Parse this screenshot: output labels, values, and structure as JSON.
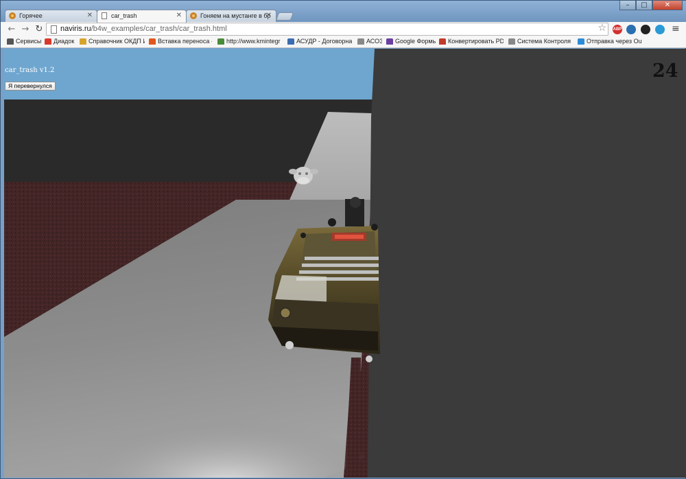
{
  "browser": {
    "tabs": [
      {
        "label": "Горячее",
        "active": false
      },
      {
        "label": "car_trash",
        "active": true
      },
      {
        "label": "Гоняем на мустанге в бр",
        "active": false
      }
    ],
    "url_host": "naviris.ru",
    "url_path": "/b4w_examples/car_trash/car_trash.html",
    "bookmarks": [
      {
        "label": "Сервисы",
        "color": "#555555"
      },
      {
        "label": "Диадок",
        "color": "#d9382c"
      },
      {
        "label": "Справочник ОКДП И",
        "color": "#d8a32a"
      },
      {
        "label": "Вставка переноса - V",
        "color": "#e2571e"
      },
      {
        "label": "http://www.kmintegr",
        "color": "#4a8a3b"
      },
      {
        "label": "АСУДР - Договорная",
        "color": "#3b6db0"
      },
      {
        "label": "АСОЗ",
        "color": "#888888"
      },
      {
        "label": "Google Формы",
        "color": "#6b3fa0"
      },
      {
        "label": "Конвертировать PDF",
        "color": "#c23b2a"
      },
      {
        "label": "Система Контроля Б",
        "color": "#888888"
      },
      {
        "label": "Отправка через Outl",
        "color": "#2e8bd6"
      }
    ],
    "extensions": [
      {
        "name": "adblock-icon",
        "text": "ABP",
        "color": "#d32f2f"
      },
      {
        "name": "extension-icon-2",
        "text": "",
        "color": "#2a6fb0"
      },
      {
        "name": "extension-icon-3",
        "text": "",
        "color": "#222222"
      },
      {
        "name": "extension-icon-4",
        "text": "",
        "color": "#2a9ad6"
      }
    ]
  },
  "game": {
    "title": "car_trash v1.2",
    "flip_button": "Я перевернулся",
    "counter": "24"
  },
  "colors": {
    "sky": "#6ea6cf",
    "ground_red": "#4a2a2a",
    "road": "#9a9a9a",
    "wall": "#3b3b3b"
  }
}
